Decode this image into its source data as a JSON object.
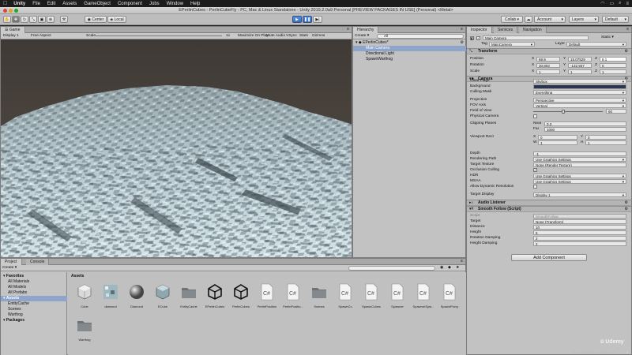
{
  "menubar": {
    "items": [
      "Unity",
      "File",
      "Edit",
      "Assets",
      "GameObject",
      "Component",
      "Jobs",
      "Window",
      "Help"
    ]
  },
  "titlebar": {
    "title": "EPerlinCubes - PerlinCubeFly - PC, Mac & Linux Standalone - Unity 2019.2.0a9 Personal [PREVIEW PACKAGES IN USE] (Personal) <Metal>"
  },
  "toolbar": {
    "center": "Center",
    "local": "Local",
    "collab": "Collab ▾",
    "account": "Account",
    "layers": "Layers",
    "layout": "Default"
  },
  "game": {
    "tab": "Game",
    "display": "Display 1",
    "aspect": "Free Aspect",
    "scale_label": "Scale",
    "scale_value": "1x",
    "maximize": "Maximize On Play",
    "mute": "Mute Audio",
    "vsync": "VSync",
    "stats": "Stats",
    "gizmos": "Gizmos"
  },
  "hierarchy": {
    "tab": "Hierarchy",
    "create": "Create ▾",
    "search_placeholder": "All",
    "scene": "EPerlinCubes*",
    "items": [
      "Main Camera",
      "Directional Light",
      "SpawnWarthog"
    ]
  },
  "inspector": {
    "tabs": [
      "Inspector",
      "Services",
      "Navigation"
    ],
    "object_name": "Main Camera",
    "static": "Static ▾",
    "tag_label": "Tag",
    "tag_value": "MainCamera",
    "layer_label": "Layer",
    "layer_value": "Default",
    "transform": {
      "title": "Transform",
      "position": {
        "label": "Position",
        "x": "69.9",
        "y": "15.07529",
        "z": "8.1"
      },
      "rotation": {
        "label": "Rotation",
        "x": "30.803",
        "y": "-132.937",
        "z": "0"
      },
      "scale": {
        "label": "Scale",
        "x": "1",
        "y": "1",
        "z": "1"
      }
    },
    "camera": {
      "title": "Camera",
      "rows": [
        {
          "label": "Clear Flags",
          "value": "Skybox"
        },
        {
          "label": "Background",
          "value": ""
        },
        {
          "label": "Culling Mask",
          "value": "Everything"
        },
        {
          "label": "Projection",
          "value": "Perspective"
        },
        {
          "label": "FOV Axis",
          "value": "Vertical"
        },
        {
          "label": "Field of View",
          "value": "60"
        },
        {
          "label": "Physical Camera",
          "value": ""
        },
        {
          "label": "Clipping Planes",
          "value": ""
        },
        {
          "label": "Viewport Rect",
          "value": ""
        },
        {
          "label": "Depth",
          "value": "-1"
        },
        {
          "label": "Rendering Path",
          "value": "Use Graphics Settings"
        },
        {
          "label": "Target Texture",
          "value": "None (Render Texture)"
        },
        {
          "label": "Occlusion Culling",
          "value": ""
        },
        {
          "label": "HDR",
          "value": "Use Graphics Settings"
        },
        {
          "label": "MSAA",
          "value": "Use Graphics Settings"
        },
        {
          "label": "Allow Dynamic Resolution",
          "value": ""
        },
        {
          "label": "Target Display",
          "value": "Display 1"
        }
      ],
      "near_label": "Near",
      "near": "0.3",
      "far_label": "Far",
      "far": "1000",
      "vx_label": "X",
      "vx": "0",
      "vy_label": "Y",
      "vy": "0",
      "vw_label": "W",
      "vw": "1",
      "vh_label": "H",
      "vh": "1"
    },
    "audio_listener": "Audio Listener",
    "smooth_follow": {
      "title": "Smooth Follow (Script)",
      "rows": [
        {
          "label": "Script",
          "value": "SmoothFollow"
        },
        {
          "label": "Target",
          "value": "None (Transform)"
        },
        {
          "label": "Distance",
          "value": "10"
        },
        {
          "label": "Height",
          "value": "5"
        },
        {
          "label": "Rotation Damping",
          "value": "2"
        },
        {
          "label": "Height Damping",
          "value": "2"
        }
      ]
    },
    "add_component": "Add Component"
  },
  "project": {
    "tabs": [
      "Project",
      "Console"
    ],
    "create": "Create ▾",
    "tree": [
      {
        "label": "Favorites",
        "bold": true,
        "indent": 0
      },
      {
        "label": "All Materials",
        "bold": false,
        "indent": 1
      },
      {
        "label": "All Models",
        "bold": false,
        "indent": 1
      },
      {
        "label": "All Prefabs",
        "bold": false,
        "indent": 1
      },
      {
        "label": "Assets",
        "bold": true,
        "indent": 0
      },
      {
        "label": "EntityCache",
        "bold": false,
        "indent": 1
      },
      {
        "label": "Scenes",
        "bold": false,
        "indent": 1
      },
      {
        "label": "Warthog",
        "bold": false,
        "indent": 1
      },
      {
        "label": "Packages",
        "bold": true,
        "indent": 0
      }
    ],
    "breadcrumb": "Assets",
    "assets": [
      {
        "name": "Cube",
        "kind": "cube"
      },
      {
        "name": "diamond",
        "kind": "texture"
      },
      {
        "name": "Diamond",
        "kind": "sphere"
      },
      {
        "name": "ECube",
        "kind": "ecube"
      },
      {
        "name": "EntityCache",
        "kind": "folder"
      },
      {
        "name": "EPerlinCubes",
        "kind": "unity"
      },
      {
        "name": "PerlinCubes",
        "kind": "unity"
      },
      {
        "name": "PerlinPosition",
        "kind": "cs"
      },
      {
        "name": "PerlinPositio...",
        "kind": "cs"
      },
      {
        "name": "Scenes",
        "kind": "folder"
      },
      {
        "name": "SpawnCu",
        "kind": "cs"
      },
      {
        "name": "SpawnCubes",
        "kind": "cs"
      },
      {
        "name": "Spawner",
        "kind": "cs"
      },
      {
        "name": "SpawnerSyst...",
        "kind": "cs"
      },
      {
        "name": "SpawnProxy",
        "kind": "cs"
      },
      {
        "name": "Warthog",
        "kind": "folder"
      }
    ]
  },
  "status": {
    "text": "Auto Generate Lighting On",
    "watermark": "Udemy"
  }
}
